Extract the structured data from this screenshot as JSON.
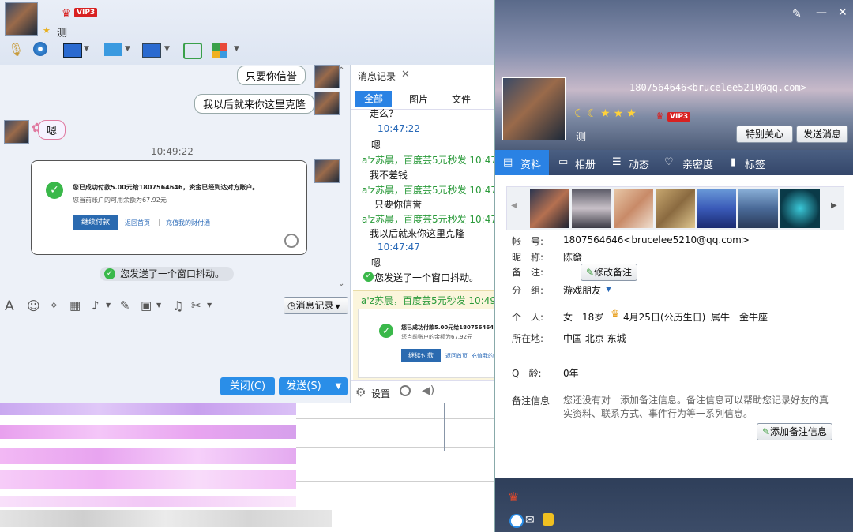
{
  "chat": {
    "contact_name": "测",
    "vip_label": "VIP3",
    "messages": {
      "out1": "只要你信誉",
      "out2": "我以后就来你这里克隆",
      "in1": "嗯",
      "time": "10:49:22"
    },
    "payment_card": {
      "title": "您已成功付款5.00元给1807564646，资金已经到达对方账户。",
      "balance": "您当前账户的可用余额为67.92元",
      "continue_btn": "继续付款",
      "link_home": "返回首页",
      "link_recharge": "充值我的财付通"
    },
    "shake_notice": "您发送了一个窗口抖动。",
    "history_btn": "消息记录",
    "close_btn": "关闭(C)",
    "send_btn": "发送(S)"
  },
  "history": {
    "title": "消息记录",
    "tabs": [
      "全部",
      "图片",
      "文件"
    ],
    "entries": [
      {
        "kind": "msg",
        "text": "走么？"
      },
      {
        "kind": "time",
        "text": "10:47:22"
      },
      {
        "kind": "msg",
        "text": "嗯"
      },
      {
        "kind": "name",
        "text": "a'z苏晨，百度芸5元秒发 10:47"
      },
      {
        "kind": "msg",
        "text": "我不差钱"
      },
      {
        "kind": "name",
        "text": "a'z苏晨，百度芸5元秒发 10:47"
      },
      {
        "kind": "msg",
        "text": "只要你信誉"
      },
      {
        "kind": "name",
        "text": "a'z苏晨，百度芸5元秒发 10:47"
      },
      {
        "kind": "msg",
        "text": "我以后就来你这里克隆"
      },
      {
        "kind": "time",
        "text": "10:47:47"
      },
      {
        "kind": "msg",
        "text": "嗯"
      }
    ],
    "shake_notice": "您发送了一个窗口抖动。",
    "last_name": "a'z苏晨，百度芸5元秒发 10:49",
    "mini_card": {
      "title": "您已成功付款5.00元给1807564646",
      "balance": "您当前账户的余额为67.92元",
      "continue_btn": "继续付款",
      "link_home": "返回首页",
      "link_recharge": "充值我的财付通"
    },
    "settings_label": "设置"
  },
  "profile": {
    "account_header": "1807564646<brucelee5210@qq.com>",
    "nickname": "测",
    "vip_label": "VIP3",
    "special_care_btn": "特别关心",
    "send_msg_btn": "发送消息",
    "tabs": [
      "资料",
      "相册",
      "动态",
      "亲密度",
      "标签"
    ],
    "fields": {
      "account_label": "帐　号:",
      "account_value": "1807564646<brucelee5210@qq.com>",
      "nick_label": "昵　称:",
      "nick_value": "陈發",
      "remark_label": "备　注:",
      "remark_btn": "修改备注",
      "group_label": "分　组:",
      "group_value": "游戏朋友",
      "personal_label": "个　人:",
      "gender": "女",
      "age": "18岁",
      "birthday": "4月25日(公历生日)",
      "zodiac": "属牛",
      "star_sign": "金牛座",
      "location_label": "所在地:",
      "location_value": "中国 北京 东城",
      "qage_label": "Q　龄:",
      "qage_value": "0年",
      "note_label": "备注信息",
      "note_text": "您还没有对　添加备注信息。备注信息可以帮助您记录好友的真实资料、联系方式、事件行为等一系列信息。",
      "add_note_btn": "添加备注信息"
    }
  },
  "colors": {
    "accent_blue": "#2a82e4",
    "vip_red": "#d82121",
    "history_green": "#2a9a3a",
    "time_blue": "#2a6ab8"
  }
}
